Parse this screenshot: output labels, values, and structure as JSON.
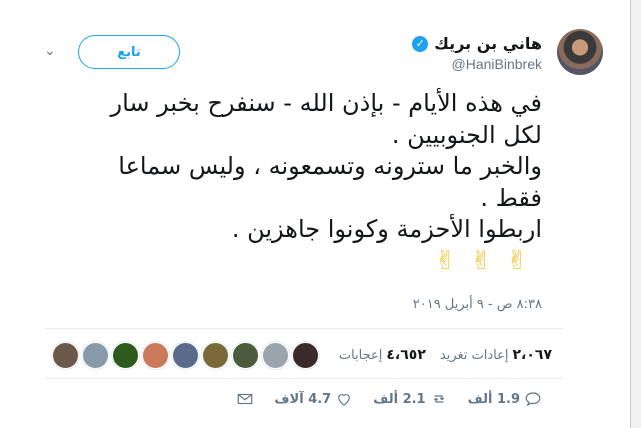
{
  "user": {
    "display_name": "هاني بن بريك",
    "handle": "@HaniBinbrek",
    "verified_glyph": "✓"
  },
  "follow_button": {
    "label": "تابع"
  },
  "caret_glyph": "⌄",
  "tweet": {
    "lines": [
      "في هذه الأيام - بإذن الله - سنفرح بخبر سار",
      "لكل الجنوبيين .",
      "والخبر ما سترونه وتسمعونه ، وليس سماعا",
      "فقط .",
      "اربطوا الأحزمة وكونوا جاهزين ."
    ],
    "emoji": "✌✌✌"
  },
  "timestamp": "٨:٣٨ ص - ٩ أبريل ٢٠١٩",
  "stats": {
    "retweets_count": "٢،٠٦٧",
    "retweets_label": "إعادات تغريد",
    "likes_count": "٤،٦٥٢",
    "likes_label": "إعجابات"
  },
  "liker_colors": [
    "#6b5a4a",
    "#8899aa",
    "#2e5a1e",
    "#c87a5a",
    "#5a6a8a",
    "#7a6a3a",
    "#4a5a3a",
    "#99a4ad",
    "#3a2a2a"
  ],
  "actions": {
    "replies": "1.9 ألف",
    "retweets": "2.1 ألف",
    "likes": "4.7 آلاف"
  },
  "colors": {
    "accent": "#1da1f2",
    "muted": "#657786",
    "text": "#14171a"
  }
}
